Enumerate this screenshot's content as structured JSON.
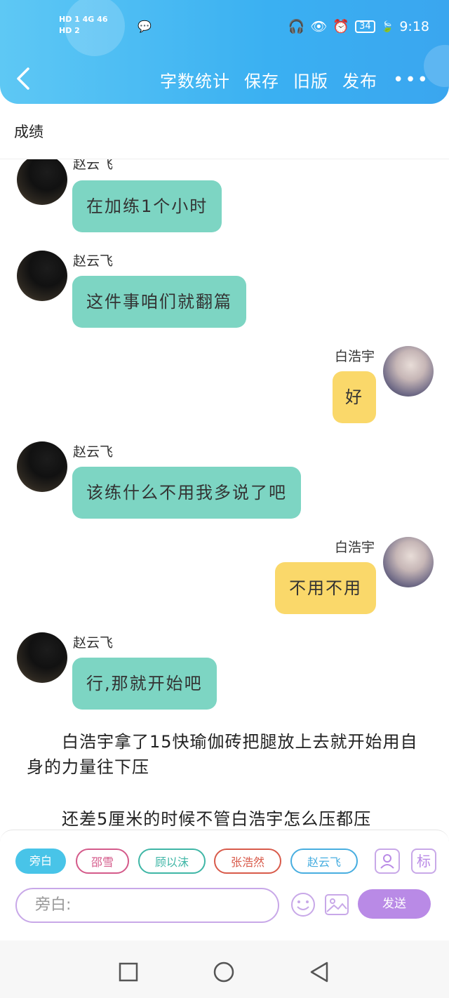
{
  "status_bar": {
    "network_left": "HD 1  4G  46",
    "network_left2": "HD 2",
    "battery": "34",
    "time": "9:18"
  },
  "nav": {
    "back_icon": "chevron-left-icon",
    "actions": [
      "字数统计",
      "保存",
      "旧版",
      "发布"
    ],
    "more": "•••"
  },
  "page_title": "成绩",
  "messages": [
    {
      "speaker": "赵云飞",
      "text": "在加练1个小时",
      "side": "left"
    },
    {
      "speaker": "赵云飞",
      "text": "这件事咱们就翻篇",
      "side": "left"
    },
    {
      "speaker": "白浩宇",
      "text": "好",
      "side": "right"
    },
    {
      "speaker": "赵云飞",
      "text": "该练什么不用我多说了吧",
      "side": "left"
    },
    {
      "speaker": "白浩宇",
      "text": "不用不用",
      "side": "right"
    },
    {
      "speaker": "赵云飞",
      "text": "行,那就开始吧",
      "side": "left"
    }
  ],
  "narration": [
    "白浩宇拿了15快瑜伽砖把腿放上去就开始用自身的力量往下压",
    "还差5厘米的时候不管白浩宇怎么压都压"
  ],
  "bottom_bar": {
    "roles": [
      "旁白",
      "邵雪",
      "顾以沫",
      "张浩然",
      "赵云飞"
    ],
    "role_colors": [
      "#48c4e8",
      "#d45a8a",
      "#3fb6a6",
      "#d85a4a",
      "#48aee0"
    ],
    "mark_label": "标",
    "input_placeholder": "旁白:",
    "send_label": "发送"
  },
  "colors": {
    "header": "#3ab0f2",
    "left_bubble": "#7dd5c3",
    "right_bubble": "#fad86a",
    "send": "#b98ae6"
  }
}
